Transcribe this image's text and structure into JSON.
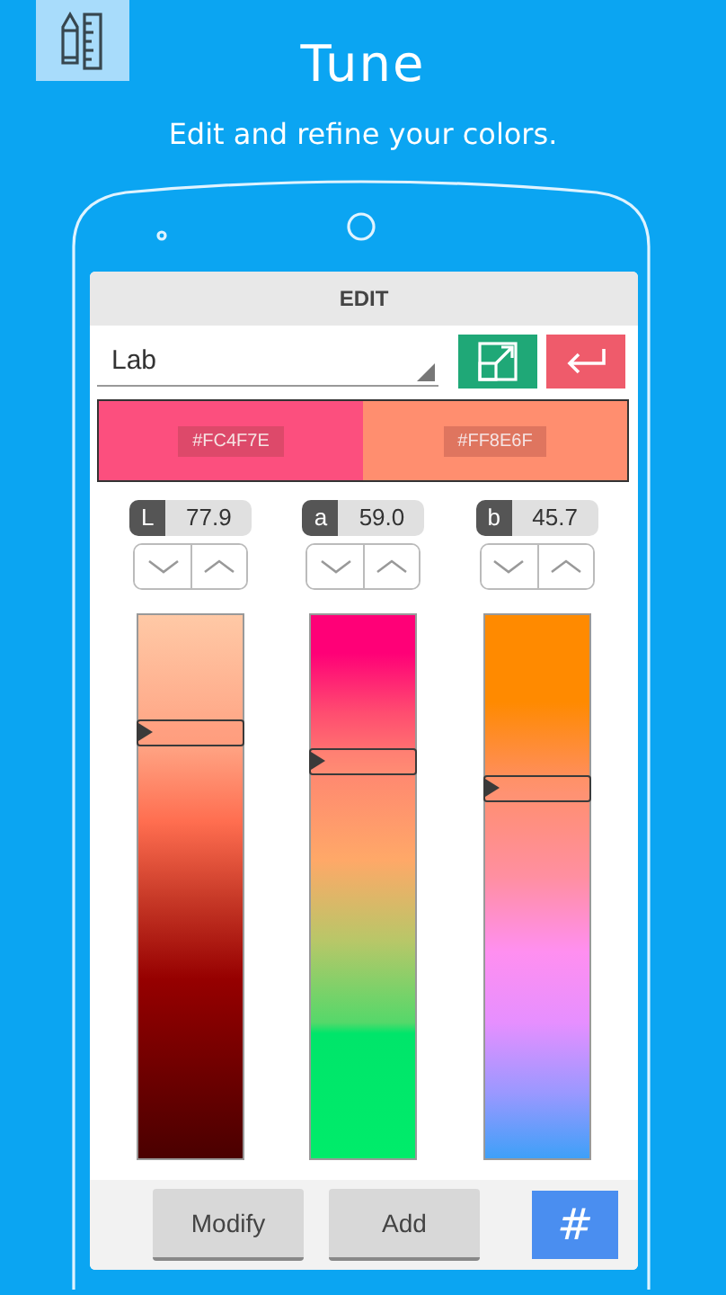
{
  "header": {
    "title": "Tune",
    "subtitle": "Edit and refine your colors."
  },
  "panel": {
    "title": "EDIT",
    "color_space": {
      "value": "Lab"
    },
    "swatches": [
      {
        "label": "#FC4F7E",
        "color": "#fc4f7e"
      },
      {
        "label": "#FF8E6F",
        "color": "#ff8e6f"
      }
    ],
    "channels": [
      {
        "label": "L",
        "value": "77.9",
        "level": 0.78
      },
      {
        "label": "a",
        "value": "59.0",
        "level": 0.73
      },
      {
        "label": "b",
        "value": "45.7",
        "level": 0.68
      }
    ],
    "buttons": [
      {
        "kind": "text",
        "label": "Modify"
      },
      {
        "kind": "text",
        "label": "Add"
      },
      {
        "kind": "hex",
        "label": "#"
      }
    ]
  }
}
